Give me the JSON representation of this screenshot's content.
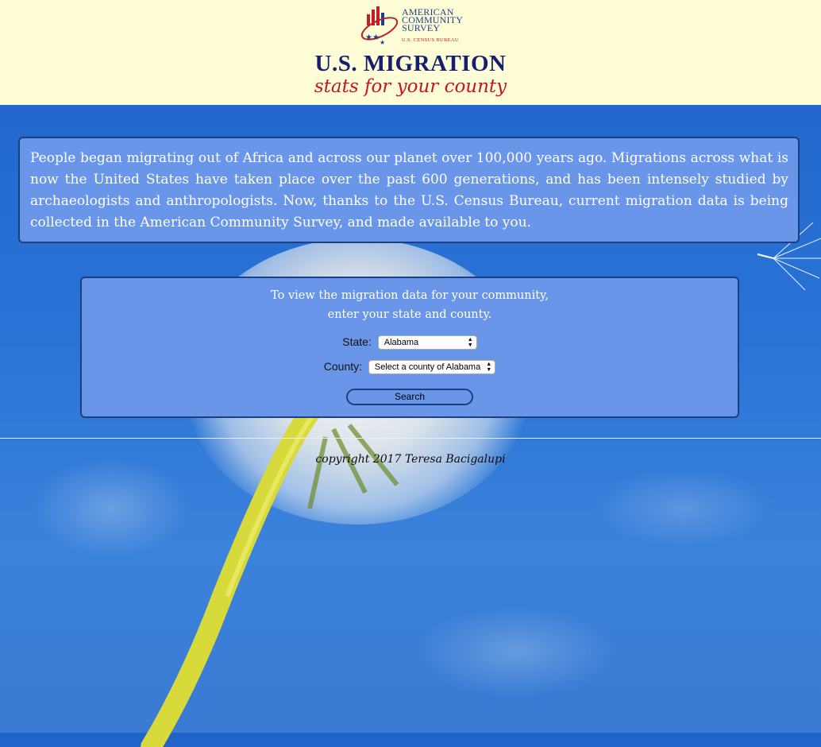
{
  "header": {
    "logo": {
      "line1": "AMERICAN",
      "line2": "COMMUNITY",
      "line3": "SURVEY",
      "sub": "U.S. CENSUS BUREAU"
    },
    "title": "U.S. MIGRATION",
    "subtitle": "stats for your county"
  },
  "intro": {
    "text": "People began migrating out of Africa and across our planet over 100,000 years ago. Migrations across what is now the United States have taken place over the past 600 generations, and has been intensely studied by archaeologists and anthropologists. Now, thanks to the U.S. Census Bureau, current migration data is being collected in the American Community Survey, and made available to you."
  },
  "form": {
    "intro_line1": "To view the migration data for your community,",
    "intro_line2": "enter your state and county.",
    "state_label": "State:",
    "state_value": "Alabama",
    "county_label": "County:",
    "county_value": "Select a county of Alabama",
    "search_label": "Search"
  },
  "footer": {
    "copyright": "copyright 2017 Teresa Bacigalupi"
  },
  "colors": {
    "header_bg": "#fffdd6",
    "title": "#14206e",
    "subtitle": "#c4152b",
    "panel_bg": "#6a96ea",
    "panel_border": "#1b3f83"
  }
}
